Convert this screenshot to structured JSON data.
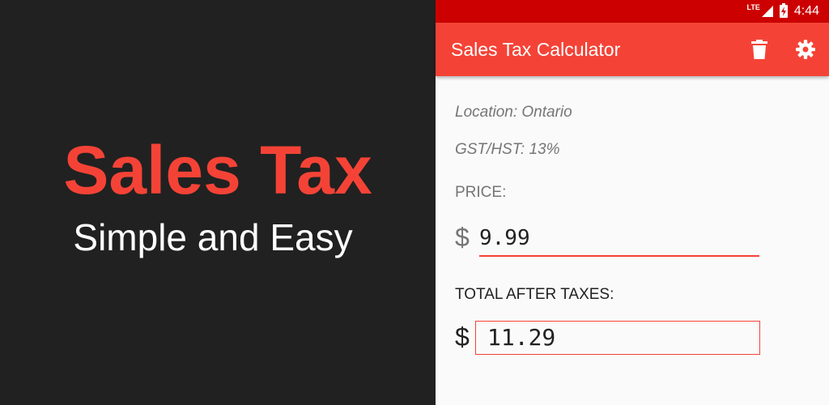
{
  "promo": {
    "title": "Sales Tax",
    "subtitle": "Simple and Easy"
  },
  "status_bar": {
    "network": "LTE",
    "time": "4:44"
  },
  "app_bar": {
    "title": "Sales Tax Calculator",
    "actions": [
      "delete-icon",
      "settings-icon"
    ]
  },
  "main": {
    "location": "Location: Ontario",
    "tax_rate": "GST/HST: 13%",
    "price_label": "PRICE:",
    "currency_symbol": "$",
    "price_value": "9.99",
    "total_label": "TOTAL AFTER TAXES:",
    "total_value": "11.29"
  },
  "colors": {
    "accent": "#f44336",
    "status_bar": "#cc0000",
    "promo_background": "#212121"
  }
}
